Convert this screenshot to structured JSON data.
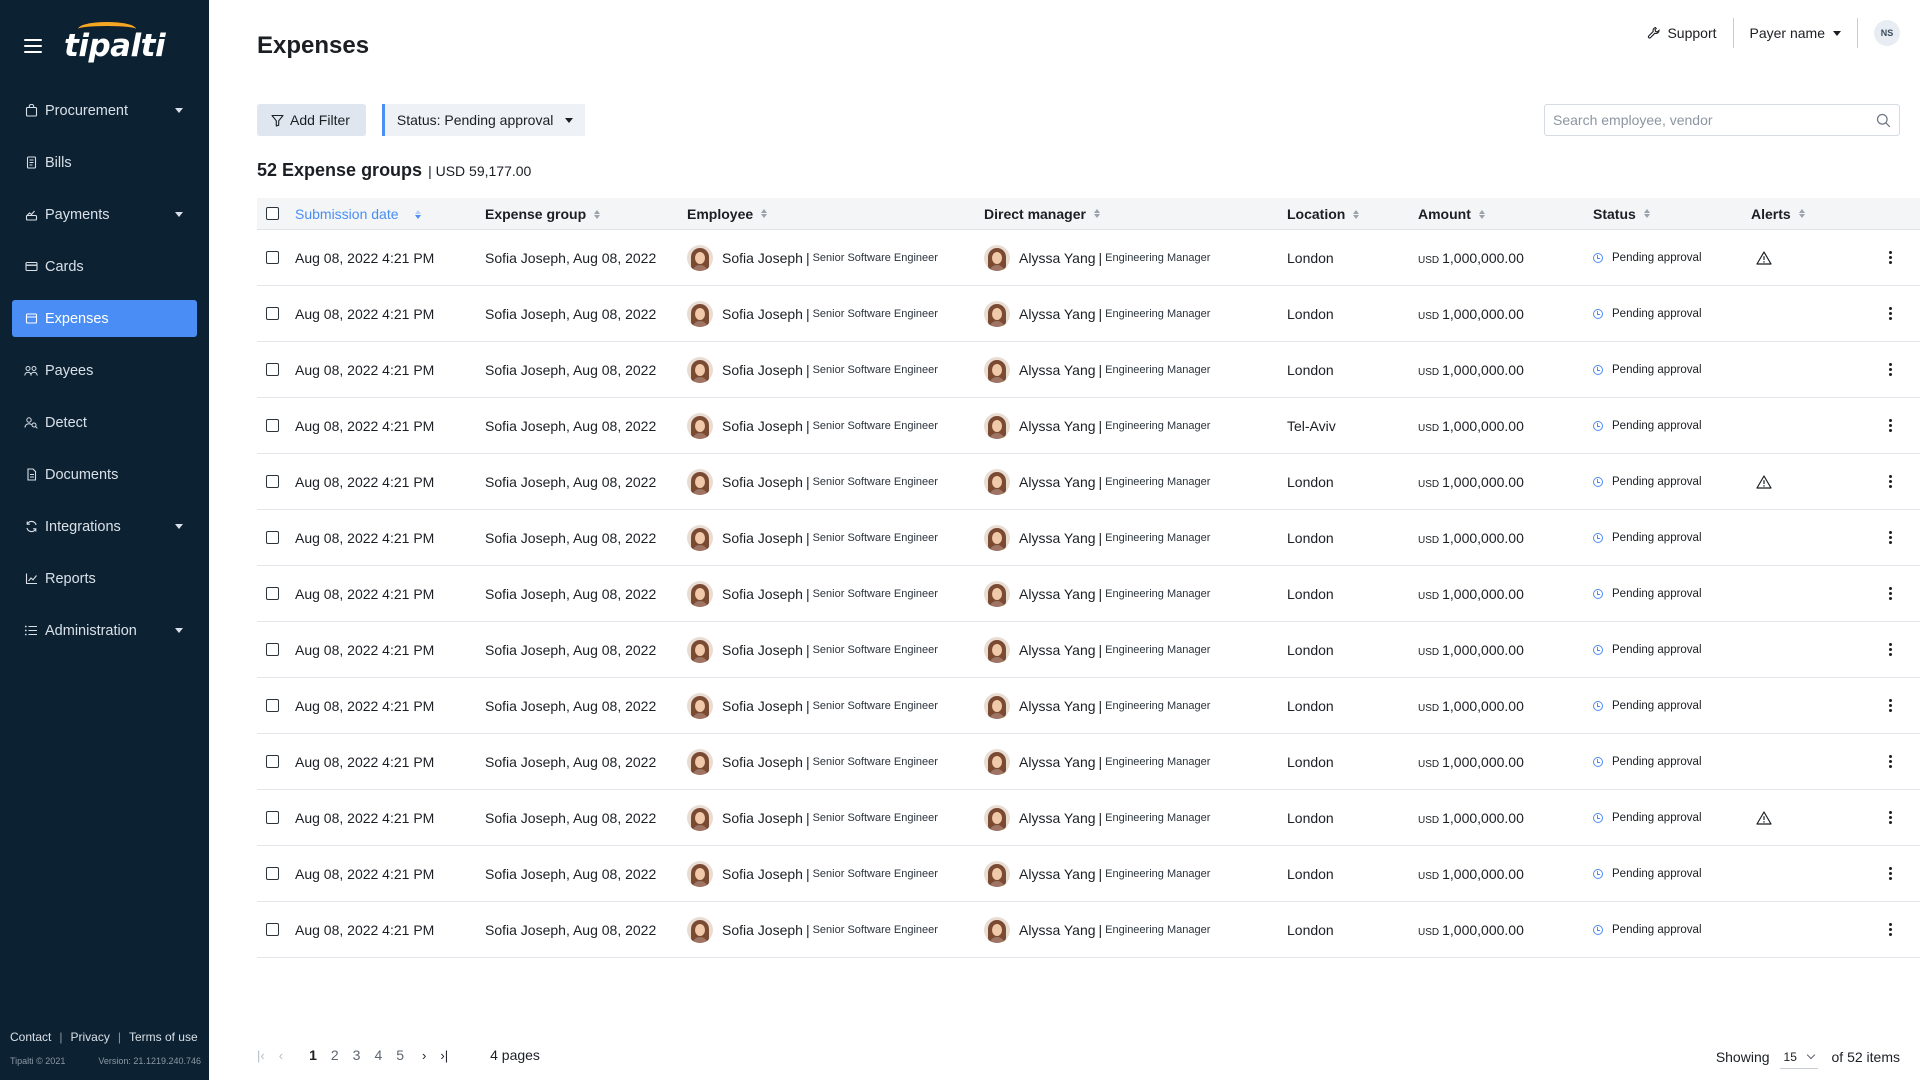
{
  "app": {
    "logo": "tipalti",
    "accent": "#4a8ef5",
    "sidebar_bg": "#0c2132",
    "logo_accent": "#f5a623"
  },
  "sidebar": {
    "items": [
      {
        "label": "Procurement",
        "icon": "bag-icon",
        "has_submenu": true
      },
      {
        "label": "Bills",
        "icon": "bill-icon",
        "has_submenu": false
      },
      {
        "label": "Payments",
        "icon": "payments-icon",
        "has_submenu": true
      },
      {
        "label": "Cards",
        "icon": "card-icon",
        "has_submenu": false
      },
      {
        "label": "Expenses",
        "icon": "expenses-icon",
        "has_submenu": false,
        "active": true
      },
      {
        "label": "Payees",
        "icon": "payees-icon",
        "has_submenu": false
      },
      {
        "label": "Detect",
        "icon": "detect-icon",
        "has_submenu": false
      },
      {
        "label": "Documents",
        "icon": "document-icon",
        "has_submenu": false
      },
      {
        "label": "Integrations",
        "icon": "sync-icon",
        "has_submenu": true
      },
      {
        "label": "Reports",
        "icon": "chart-icon",
        "has_submenu": false
      },
      {
        "label": "Administration",
        "icon": "list-settings-icon",
        "has_submenu": true
      }
    ],
    "footer": {
      "contact": "Contact",
      "privacy": "Privacy",
      "terms": "Terms of use",
      "copyright": "Tipalti © 2021",
      "version": "Version: 21.1219.240.746"
    }
  },
  "header": {
    "title": "Expenses",
    "support": "Support",
    "payer": "Payer name",
    "user_initials": "NS"
  },
  "filters": {
    "add_filter": "Add Filter",
    "status_chip": "Status: Pending approval",
    "search_placeholder": "Search employee, vendor"
  },
  "summary": {
    "count": "52 Expense groups",
    "total": "| USD 59,177.00"
  },
  "table": {
    "columns": [
      "Submission date",
      "Expense group",
      "Employee",
      "Direct manager",
      "Location",
      "Amount",
      "Status",
      "Alerts"
    ],
    "sorted_column": "Submission date",
    "rows": [
      {
        "date": "Aug 08, 2022 4:21 PM",
        "group": "Sofia Joseph, Aug 08, 2022",
        "employee": "Sofia Joseph",
        "employee_role": "Senior Software Engineer",
        "manager": "Alyssa Yang",
        "manager_role": "Engineering Manager",
        "location": "London",
        "currency": "USD",
        "amount": "1,000,000.00",
        "status": "Pending approval",
        "alert": true
      },
      {
        "date": "Aug 08, 2022 4:21 PM",
        "group": "Sofia Joseph, Aug 08, 2022",
        "employee": "Sofia Joseph",
        "employee_role": "Senior Software Engineer",
        "manager": "Alyssa Yang",
        "manager_role": "Engineering Manager",
        "location": "London",
        "currency": "USD",
        "amount": "1,000,000.00",
        "status": "Pending approval",
        "alert": false
      },
      {
        "date": "Aug 08, 2022 4:21 PM",
        "group": "Sofia Joseph, Aug 08, 2022",
        "employee": "Sofia Joseph",
        "employee_role": "Senior Software Engineer",
        "manager": "Alyssa Yang",
        "manager_role": "Engineering Manager",
        "location": "London",
        "currency": "USD",
        "amount": "1,000,000.00",
        "status": "Pending approval",
        "alert": false
      },
      {
        "date": "Aug 08, 2022 4:21 PM",
        "group": "Sofia Joseph, Aug 08, 2022",
        "employee": "Sofia Joseph",
        "employee_role": "Senior Software Engineer",
        "manager": "Alyssa Yang",
        "manager_role": "Engineering Manager",
        "location": "Tel-Aviv",
        "currency": "USD",
        "amount": "1,000,000.00",
        "status": "Pending approval",
        "alert": false
      },
      {
        "date": "Aug 08, 2022 4:21 PM",
        "group": "Sofia Joseph, Aug 08, 2022",
        "employee": "Sofia Joseph",
        "employee_role": "Senior Software Engineer",
        "manager": "Alyssa Yang",
        "manager_role": "Engineering Manager",
        "location": "London",
        "currency": "USD",
        "amount": "1,000,000.00",
        "status": "Pending approval",
        "alert": true
      },
      {
        "date": "Aug 08, 2022 4:21 PM",
        "group": "Sofia Joseph, Aug 08, 2022",
        "employee": "Sofia Joseph",
        "employee_role": "Senior Software Engineer",
        "manager": "Alyssa Yang",
        "manager_role": "Engineering Manager",
        "location": "London",
        "currency": "USD",
        "amount": "1,000,000.00",
        "status": "Pending approval",
        "alert": false
      },
      {
        "date": "Aug 08, 2022 4:21 PM",
        "group": "Sofia Joseph, Aug 08, 2022",
        "employee": "Sofia Joseph",
        "employee_role": "Senior Software Engineer",
        "manager": "Alyssa Yang",
        "manager_role": "Engineering Manager",
        "location": "London",
        "currency": "USD",
        "amount": "1,000,000.00",
        "status": "Pending approval",
        "alert": false
      },
      {
        "date": "Aug 08, 2022 4:21 PM",
        "group": "Sofia Joseph, Aug 08, 2022",
        "employee": "Sofia Joseph",
        "employee_role": "Senior Software Engineer",
        "manager": "Alyssa Yang",
        "manager_role": "Engineering Manager",
        "location": "London",
        "currency": "USD",
        "amount": "1,000,000.00",
        "status": "Pending approval",
        "alert": false
      },
      {
        "date": "Aug 08, 2022 4:21 PM",
        "group": "Sofia Joseph, Aug 08, 2022",
        "employee": "Sofia Joseph",
        "employee_role": "Senior Software Engineer",
        "manager": "Alyssa Yang",
        "manager_role": "Engineering Manager",
        "location": "London",
        "currency": "USD",
        "amount": "1,000,000.00",
        "status": "Pending approval",
        "alert": false
      },
      {
        "date": "Aug 08, 2022 4:21 PM",
        "group": "Sofia Joseph, Aug 08, 2022",
        "employee": "Sofia Joseph",
        "employee_role": "Senior Software Engineer",
        "manager": "Alyssa Yang",
        "manager_role": "Engineering Manager",
        "location": "London",
        "currency": "USD",
        "amount": "1,000,000.00",
        "status": "Pending approval",
        "alert": false
      },
      {
        "date": "Aug 08, 2022 4:21 PM",
        "group": "Sofia Joseph, Aug 08, 2022",
        "employee": "Sofia Joseph",
        "employee_role": "Senior Software Engineer",
        "manager": "Alyssa Yang",
        "manager_role": "Engineering Manager",
        "location": "London",
        "currency": "USD",
        "amount": "1,000,000.00",
        "status": "Pending approval",
        "alert": true
      },
      {
        "date": "Aug 08, 2022 4:21 PM",
        "group": "Sofia Joseph, Aug 08, 2022",
        "employee": "Sofia Joseph",
        "employee_role": "Senior Software Engineer",
        "manager": "Alyssa Yang",
        "manager_role": "Engineering Manager",
        "location": "London",
        "currency": "USD",
        "amount": "1,000,000.00",
        "status": "Pending approval",
        "alert": false
      },
      {
        "date": "Aug 08, 2022 4:21 PM",
        "group": "Sofia Joseph, Aug 08, 2022",
        "employee": "Sofia Joseph",
        "employee_role": "Senior Software Engineer",
        "manager": "Alyssa Yang",
        "manager_role": "Engineering Manager",
        "location": "London",
        "currency": "USD",
        "amount": "1,000,000.00",
        "status": "Pending approval",
        "alert": false
      }
    ]
  },
  "pagination": {
    "pages": [
      "1",
      "2",
      "3",
      "4",
      "5"
    ],
    "current_page": "1",
    "pages_label": "4 pages",
    "showing_label": "Showing",
    "per_page": "15",
    "of_items": "of 52 items"
  }
}
